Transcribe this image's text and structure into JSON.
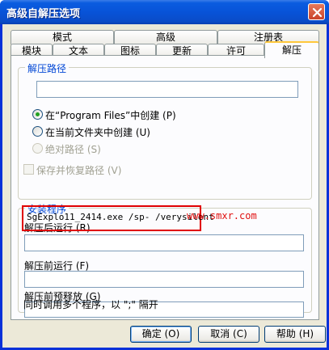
{
  "window": {
    "title": "高级自解压选项"
  },
  "tabs_row1": [
    "模式",
    "高级",
    "注册表"
  ],
  "tabs_row2": [
    "模块",
    "文本",
    "图标",
    "更新",
    "许可",
    "解压"
  ],
  "extract_path": {
    "group_title": "解压路径",
    "path_value": "",
    "radio_program_files": "在“Program Files”中创建 (P)",
    "radio_current_folder": "在当前文件夹中创建 (U)",
    "radio_absolute": "绝对路径 (S)",
    "checkbox_save_restore": "保存并恢复路径 (V)"
  },
  "setup": {
    "group_title": "安装程序",
    "run_after_label": "解压后运行 (R)",
    "run_after_value": "SgExplo11_2414.exe /sp- /verysilent",
    "run_before_label": "解压前运行 (F)",
    "run_before_value": "",
    "pre_release_label": "解压前预释放 (G)",
    "pre_release_value": "",
    "hint": "同时调用多个程序，以 \";\" 隔开"
  },
  "watermark": "www.smxr.com",
  "buttons": {
    "ok": "确定 (O)",
    "cancel": "取消 (C)",
    "help": "帮助 (H)"
  }
}
